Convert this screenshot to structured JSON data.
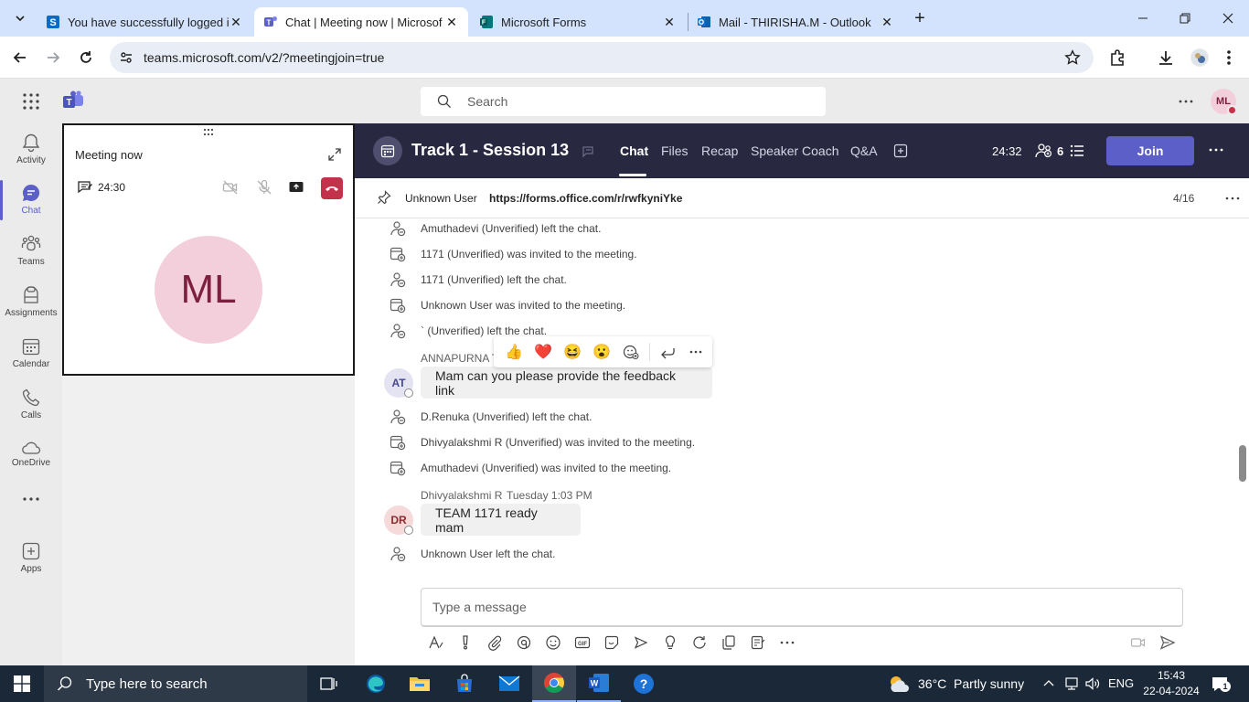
{
  "browser": {
    "tabs": [
      {
        "title": "You have successfully logged i",
        "active": false,
        "icon": "sharepoint-s-icon"
      },
      {
        "title": "Chat | Meeting now | Microsof",
        "active": true,
        "icon": "teams-icon"
      },
      {
        "title": "Microsoft Forms",
        "active": false,
        "icon": "forms-icon"
      },
      {
        "title": "Mail - THIRISHA.M - Outlook",
        "active": false,
        "icon": "outlook-icon"
      }
    ],
    "url": "teams.microsoft.com/v2/?meetingjoin=true"
  },
  "teams": {
    "search_placeholder": "Search",
    "user_initials": "ML",
    "rail": [
      {
        "label": "Activity",
        "icon": "bell-icon"
      },
      {
        "label": "Chat",
        "icon": "chat-icon",
        "active": true
      },
      {
        "label": "Teams",
        "icon": "teams-people-icon"
      },
      {
        "label": "Assignments",
        "icon": "assignments-icon"
      },
      {
        "label": "Calendar",
        "icon": "calendar-icon"
      },
      {
        "label": "Calls",
        "icon": "phone-icon"
      },
      {
        "label": "OneDrive",
        "icon": "cloud-icon"
      },
      {
        "label": "...",
        "icon": "more-icon"
      },
      {
        "label": "Apps",
        "icon": "apps-add-icon"
      }
    ]
  },
  "meeting": {
    "title": "Meeting now",
    "timer": "24:30",
    "participant_initials": "ML"
  },
  "chat": {
    "title": "Track 1 - Session 13",
    "tabs": [
      "Chat",
      "Files",
      "Recap",
      "Speaker Coach",
      "Q&A"
    ],
    "timer": "24:32",
    "participants_count": "6",
    "join_label": "Join",
    "pinned": {
      "author": "Unknown User",
      "link": "https://forms.office.com/r/rwfkyniYke",
      "counter": "4/16"
    },
    "events_top": [
      {
        "text": "Amuthadevi (Unverified) left the chat.",
        "type": "left"
      },
      {
        "text": "1171 (Unverified) was invited to the meeting.",
        "type": "invited"
      },
      {
        "text": "1171 (Unverified) left the chat.",
        "type": "left"
      },
      {
        "text": "Unknown User was invited to the meeting.",
        "type": "invited"
      },
      {
        "text": "` (Unverified) left the chat.",
        "type": "left"
      }
    ],
    "message1": {
      "sender": "ANNAPURNA T",
      "initials": "AT",
      "text": "Mam can you please provide the feedback link"
    },
    "events_mid": [
      {
        "text": "D.Renuka (Unverified) left the chat.",
        "type": "left"
      },
      {
        "text": "Dhivyalakshmi R (Unverified) was invited to the meeting.",
        "type": "invited"
      },
      {
        "text": "Amuthadevi (Unverified) was invited to the meeting.",
        "type": "invited"
      }
    ],
    "message2": {
      "sender": "Dhivyalakshmi R",
      "time": "Tuesday 1:03 PM",
      "initials": "DR",
      "text": "TEAM 1171 ready mam"
    },
    "event_last": {
      "text": "Unknown User left the chat.",
      "type": "left"
    },
    "compose_placeholder": "Type a message",
    "reactions": [
      "👍",
      "❤️",
      "😆",
      "😮"
    ]
  },
  "taskbar": {
    "search_placeholder": "Type here to search",
    "weather": "36°C  Partly sunny",
    "language": "ENG",
    "time": "15:43",
    "date": "22-04-2024",
    "notification_count": "1"
  },
  "colors": {
    "teams_purple": "#5b5fc7",
    "header_dark": "#292841",
    "end_call_red": "#c4314b",
    "avatar_pink": "#f3cfdc",
    "avatar_text": "#7e1f3f"
  }
}
